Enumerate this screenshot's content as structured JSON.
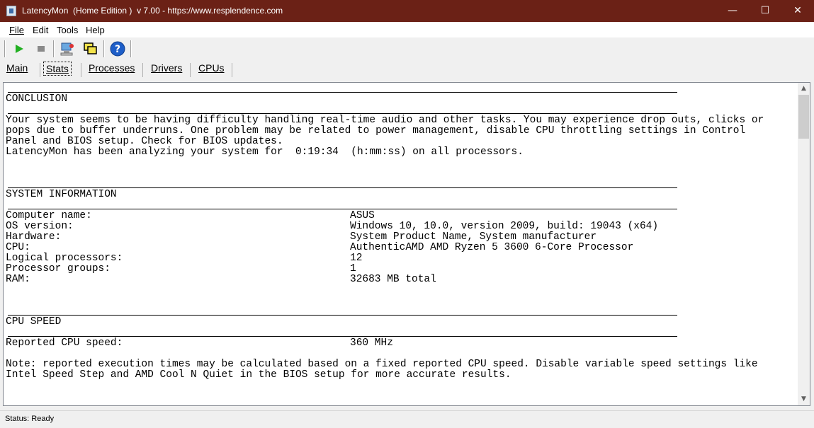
{
  "window": {
    "title": "LatencyMon  (Home Edition )  v 7.00 - https://www.resplendence.com",
    "minimize_glyph": "—",
    "maximize_glyph": "☐",
    "close_glyph": "✕"
  },
  "menu": {
    "file": "File",
    "edit": "Edit",
    "tools": "Tools",
    "help": "Help"
  },
  "toolbar": {
    "icons": [
      "play-icon",
      "stop-icon",
      "pc-icon",
      "windows-icon",
      "help-icon"
    ],
    "help_glyph": "?"
  },
  "tabs": {
    "main": "Main",
    "stats": "Stats",
    "processes": "Processes",
    "drivers": "Drivers",
    "cpus": "CPUs",
    "active": "stats"
  },
  "report": {
    "conclusion_header": "CONCLUSION",
    "conclusion_lines": [
      "Your system seems to be having difficulty handling real-time audio and other tasks. You may experience drop outs, clicks or",
      "pops due to buffer underruns. One problem may be related to power management, disable CPU throttling settings in Control",
      "Panel and BIOS setup. Check for BIOS updates.",
      "LatencyMon has been analyzing your system for  0:19:34  (h:mm:ss) on all processors."
    ],
    "sysinfo_header": "SYSTEM INFORMATION",
    "sysinfo": [
      {
        "label": "Computer name:",
        "value": "ASUS"
      },
      {
        "label": "OS version:",
        "value": "Windows 10, 10.0, version 2009, build: 19043 (x64)"
      },
      {
        "label": "Hardware:",
        "value": "System Product Name, System manufacturer"
      },
      {
        "label": "CPU:",
        "value": "AuthenticAMD AMD Ryzen 5 3600 6-Core Processor"
      },
      {
        "label": "Logical processors:",
        "value": "12"
      },
      {
        "label": "Processor groups:",
        "value": "1"
      },
      {
        "label": "RAM:",
        "value": "32683 MB total"
      }
    ],
    "cpuspeed_header": "CPU SPEED",
    "cpuspeed": {
      "label": "Reported CPU speed:",
      "value": "360 MHz"
    },
    "note_lines": [
      "Note: reported execution times may be calculated based on a fixed reported CPU speed. Disable variable speed settings like",
      "Intel Speed Step and AMD Cool N Quiet in the BIOS setup for more accurate results."
    ]
  },
  "scroll": {
    "up_glyph": "▲",
    "down_glyph": "▼"
  },
  "status": {
    "text": "Status: Ready"
  },
  "colors": {
    "titlebar": "#6b2116",
    "play": "#22b022",
    "help": "#1e5ec8"
  }
}
